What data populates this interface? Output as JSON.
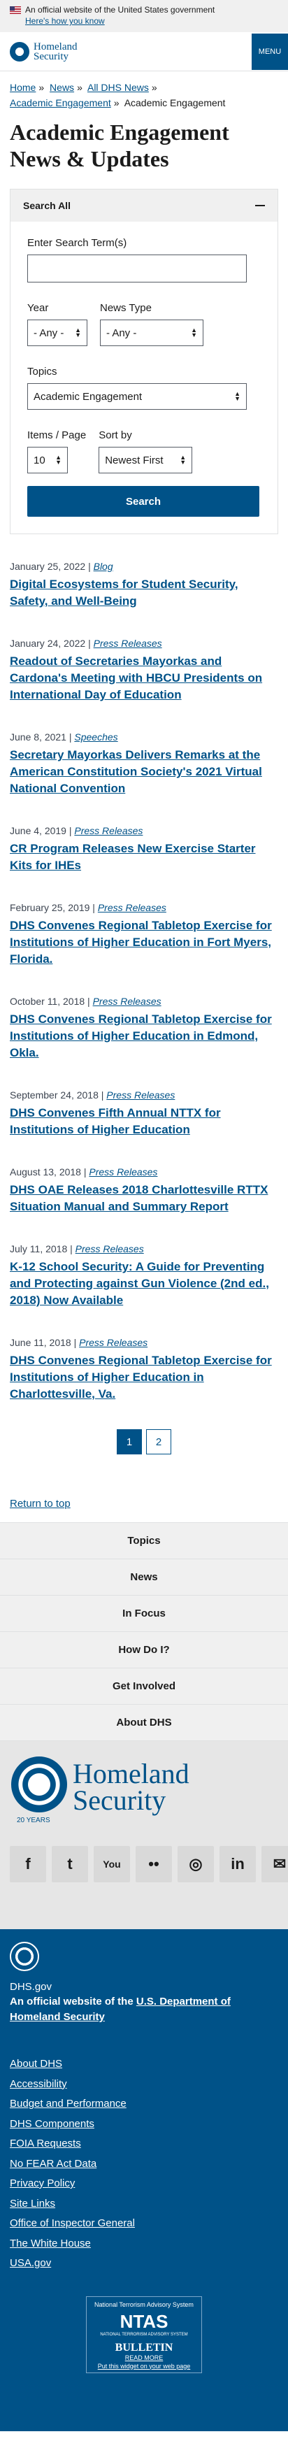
{
  "gov_banner": {
    "text": "An official website of the United States government",
    "link": "Here's how you know"
  },
  "header": {
    "logo_line1": "Homeland",
    "logo_line2": "Security",
    "menu_label": "MENU"
  },
  "breadcrumb": {
    "home": "Home",
    "news": "News",
    "all_news": "All DHS News",
    "academic": "Academic Engagement",
    "current": "Academic Engagement"
  },
  "page_title": "Academic Engagement News & Updates",
  "search": {
    "header": "Search All",
    "term_label": "Enter Search Term(s)",
    "term_value": "",
    "year_label": "Year",
    "year_value": "- Any -",
    "news_type_label": "News Type",
    "news_type_value": "- Any -",
    "topics_label": "Topics",
    "topics_value": "Academic Engagement",
    "items_label": "Items / Page",
    "items_value": "10",
    "sort_label": "Sort by",
    "sort_value": "Newest First",
    "button": "Search"
  },
  "results": [
    {
      "date": "January 25, 2022 |",
      "type": "Blog",
      "title": "Digital Ecosystems for Student Security, Safety, and Well-Being"
    },
    {
      "date": "January 24, 2022 |",
      "type": "Press Releases",
      "title": "Readout of Secretaries Mayorkas and Cardona's Meeting with HBCU Presidents on International Day of Education"
    },
    {
      "date": "June 8, 2021 |",
      "type": "Speeches",
      "title": "Secretary Mayorkas Delivers Remarks at the American Constitution Society's 2021 Virtual National Convention"
    },
    {
      "date": "June 4, 2019 |",
      "type": "Press Releases",
      "title": "CR Program Releases New Exercise Starter Kits for IHEs"
    },
    {
      "date": "February 25, 2019 |",
      "type": "Press Releases",
      "title": "DHS Convenes Regional Tabletop Exercise for Institutions of Higher Education in Fort Myers, Florida."
    },
    {
      "date": "October 11, 2018 |",
      "type": "Press Releases",
      "title": "DHS Convenes Regional Tabletop Exercise for Institutions of Higher Education in Edmond, Okla."
    },
    {
      "date": "September 24, 2018 |",
      "type": "Press Releases",
      "title": "DHS Convenes Fifth Annual NTTX for Institutions of Higher Education"
    },
    {
      "date": "August 13, 2018 |",
      "type": "Press Releases",
      "title": "DHS OAE Releases 2018 Charlottesville RTTX Situation Manual and Summary Report"
    },
    {
      "date": "July 11, 2018 |",
      "type": "Press Releases",
      "title": "K-12 School Security: A Guide for Preventing and Protecting against Gun Violence (2nd ed., 2018) Now Available"
    },
    {
      "date": "June 11, 2018 |",
      "type": "Press Releases",
      "title": "DHS Convenes Regional Tabletop Exercise for Institutions of Higher Education in Charlottesville, Va."
    }
  ],
  "pager": {
    "page1": "1",
    "page2": "2"
  },
  "return_top": "Return to top",
  "footer_nav": [
    "Topics",
    "News",
    "In Focus",
    "How Do I?",
    "Get Involved",
    "About DHS"
  ],
  "footer_logo": {
    "line1": "Homeland",
    "line2": "Security",
    "years": "20 YEARS"
  },
  "social": {
    "facebook": "f",
    "twitter": "t",
    "youtube": "You",
    "flickr": "••",
    "instagram": "◎",
    "linkedin": "in",
    "email": "✉"
  },
  "dark_footer": {
    "site": "DHS.gov",
    "official_prefix": "An official website of the",
    "official_link": "U.S. Department of Homeland Security",
    "links": [
      "About DHS",
      "Accessibility",
      "Budget and Performance",
      "DHS Components",
      "FOIA Requests",
      "No FEAR Act Data",
      "Privacy Policy",
      "Site Links",
      "Office of Inspector General",
      "The White House",
      "USA.gov"
    ]
  },
  "ntas": {
    "top": "National Terrorism Advisory System",
    "mark": "NTAS",
    "sub": "NATIONAL TERRORISM ADVISORY SYSTEM",
    "bulletin": "BULLETIN",
    "read_more": "READ MORE",
    "widget": "Put this widget on your web page"
  },
  "colors": {
    "primary": "#005288",
    "banner_bg": "#f0f0f0",
    "footer_bg": "#005288"
  }
}
